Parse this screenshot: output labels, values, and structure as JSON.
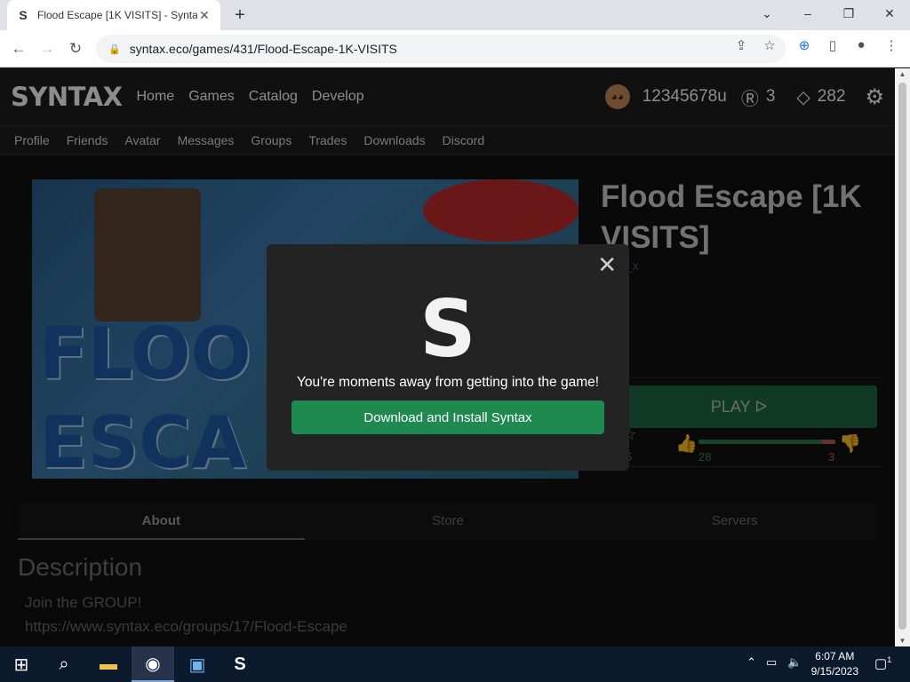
{
  "browser": {
    "tab_title": "Flood Escape [1K VISITS] - Syntax",
    "tab_favicon": "S",
    "new_tab_label": "+",
    "url": "syntax.eco/games/431/Flood-Escape-1K-VISITS",
    "window_controls": {
      "minimize": "–",
      "restore": "❐",
      "close": "✕",
      "tabsearch": "⌄"
    }
  },
  "site": {
    "logo": "SYNTAX",
    "main_nav": [
      "Home",
      "Games",
      "Catalog",
      "Develop"
    ],
    "username": "12345678u",
    "robux": "3",
    "tickets": "282",
    "sub_nav": [
      "Profile",
      "Friends",
      "Avatar",
      "Messages",
      "Groups",
      "Trades",
      "Downloads",
      "Discord"
    ]
  },
  "game": {
    "title": "Flood Escape [1K VISITS]",
    "creator": "_x",
    "play_label": "PLAY ᐅ",
    "favorites": "5",
    "upvotes": "28",
    "downvotes": "3",
    "upvote_share": 0.9,
    "thumbnail_text_line1": "FLOO",
    "thumbnail_text_line2": "ESCA"
  },
  "tabs": [
    "About",
    "Store",
    "Servers"
  ],
  "description": {
    "heading": "Description",
    "lines": [
      "Join the GROUP!",
      "https://www.syntax.eco/groups/17/Flood-Escape"
    ]
  },
  "modal": {
    "logo": "S",
    "message": "You're moments away from getting into the game!",
    "button": "Download and Install Syntax",
    "close": "✕"
  },
  "taskbar": {
    "time": "6:07 AM",
    "date": "9/15/2023",
    "notification_count": "1"
  },
  "colors": {
    "accent_green": "#1f8a4f",
    "play_green": "#1f6b45",
    "header_bg": "#1e1e1e"
  }
}
